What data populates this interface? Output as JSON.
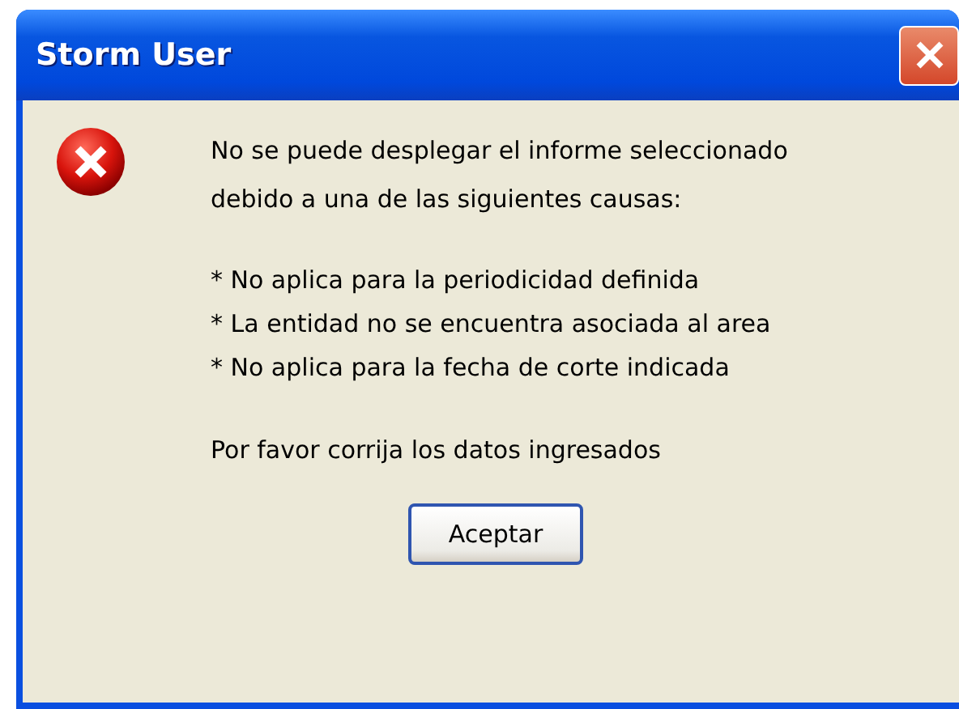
{
  "window": {
    "title": "Storm User"
  },
  "message": [
    "No se puede desplegar el informe seleccionado",
    "debido a una de las siguientes causas:"
  ],
  "causes": [
    "* No aplica para la periodicidad definida",
    "* La entidad no se encuentra asociada al area",
    "* No aplica para la fecha de corte indicada"
  ],
  "footer": "Por favor corrija los datos ingresados",
  "buttons": [
    "Aceptar"
  ]
}
